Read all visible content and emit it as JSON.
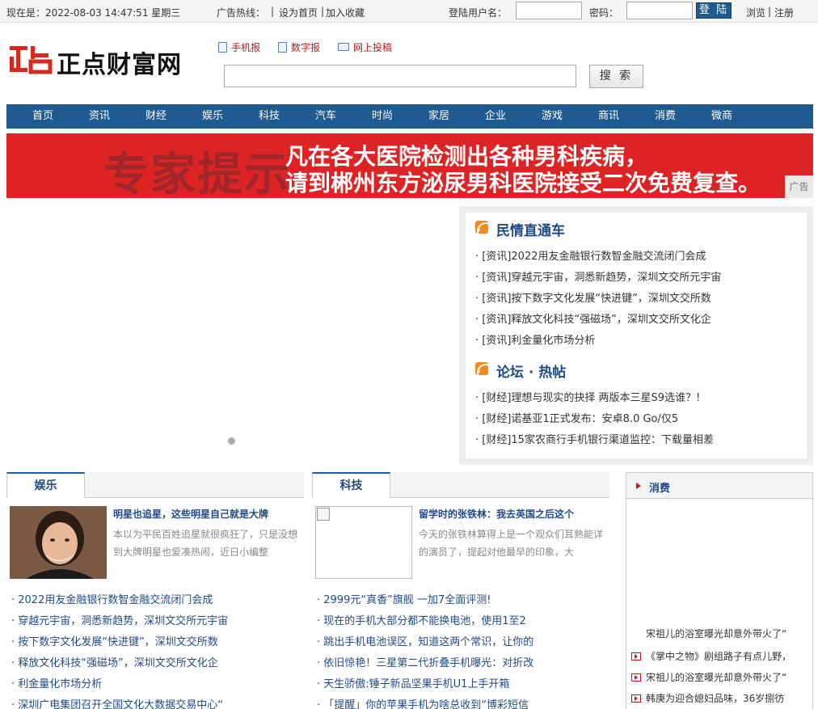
{
  "topbar": {
    "date_text": "现在是：2022-08-03 14:47:51 星期三",
    "hotline_label": "广告热线：",
    "separator": "|",
    "set_home": "设为首页",
    "add_favorite": "加入收藏",
    "username_label": "登陆用户名：",
    "password_label": "密码：",
    "login_button": "登 陆",
    "browse": "浏览",
    "register": "注册"
  },
  "header": {
    "logo_mark": "正点",
    "logo_text": "正点财富网",
    "links": [
      {
        "label": "手机报",
        "icon": "phone-icon"
      },
      {
        "label": "数字报",
        "icon": "document-icon"
      },
      {
        "label": "网上投稿",
        "icon": "mail-icon"
      }
    ],
    "search_button": "搜 索"
  },
  "nav": [
    "首页",
    "资讯",
    "财经",
    "娱乐",
    "科技",
    "汽车",
    "时尚",
    "家居",
    "企业",
    "游戏",
    "商讯",
    "消费",
    "微商"
  ],
  "banner": {
    "big_text": "专家提示",
    "line1": "凡在各大医院检测出各种男科疾病，",
    "line2": "请到郴州东方泌尿男科医院接受二次免费复查。",
    "ad_label": "广告"
  },
  "panel": {
    "section1_title": "民情直通车",
    "section1_items": [
      "· [资讯]2022用友金融银行数智金融交流闭门会成",
      "· [资讯]穿越元宇宙，洞悉新趋势，深圳文交所元宇宙",
      "· [资讯]按下数字文化发展“快进键”，深圳文交所数",
      "· [资讯]释放文化科技“强磁场”，深圳文交所文化企",
      "· [资讯]利金量化市场分析"
    ],
    "section2_title": "论坛 · 热帖",
    "section2_items": [
      "· [财经]理想与现实的抉择 两版本三星S9选谁？!",
      "· [财经]诺基亚1正式发布：安卓8.0 Go/仅5",
      "· [财经]15家农商行手机银行渠道监控：下载量相差"
    ]
  },
  "entertainment": {
    "tab": "娱乐",
    "headline": "明星也追星，这些明星自己就是大牌",
    "summary": [
      "本以为平民百姓追星就很疯狂了，只是没想",
      "到大牌明星也爱凑热闹，近日小编整"
    ],
    "items": [
      "· 2022用友金融银行数智金融交流闭门会成",
      "· 穿越元宇宙，洞悉新趋势，深圳文交所元宇宙",
      "· 按下数字文化发展“快进键”，深圳文交所数",
      "· 释放文化科技“强磁场”，深圳文交所文化企",
      "· 利金量化市场分析",
      "· 深圳广电集团召开全国文化大数据交易中心“"
    ]
  },
  "tech": {
    "tab": "科技",
    "headline": "留学时的张铁林：我去英国之后这个",
    "summary": [
      "今天的张铁林算得上是一个观众们耳熟能详",
      "的演员了，提起对他最早的印象，大"
    ],
    "items": [
      "· 2999元“真香”旗舰 一加7全面评测!",
      "· 现在的手机大部分都不能换电池，使用1至2",
      "· 跳出手机电池误区，知道这两个常识，让你的",
      "· 依旧惊艳！三星第二代折叠手机曝光：对折改",
      "· 天生骄傲:锤子新品坚果手机U1上手开箱",
      "· 「提醒」你的苹果手机为啥总收到“博彩短信"
    ]
  },
  "consumer": {
    "title": "消费",
    "caption": "宋祖儿的浴室曝光却意外带火了“",
    "items": [
      "《掌中之物》剧组路子有点儿野，",
      "宋祖儿的浴室曝光却意外带火了“",
      "韩庚为迎合媳妇品味，36岁捌彷"
    ]
  }
}
